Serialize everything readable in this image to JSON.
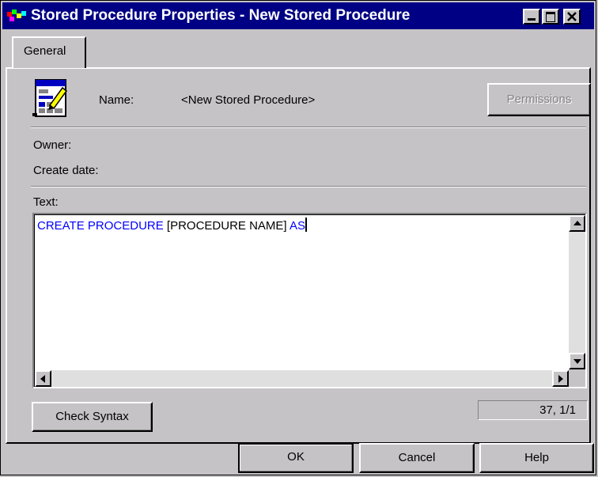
{
  "window": {
    "title": "Stored Procedure Properties - New Stored Procedure",
    "app_icon": "app-icon",
    "controls": [
      "minimize-icon",
      "maximize-icon",
      "close-icon"
    ]
  },
  "tabs": [
    {
      "label": "General",
      "selected": true
    }
  ],
  "general": {
    "name_label": "Name:",
    "name_value": "<New Stored Procedure>",
    "permissions_label": "Permissions",
    "owner_label": "Owner:",
    "create_date_label": "Create date:",
    "text_label": "Text:",
    "code": {
      "kw1": "CREATE PROCEDURE",
      "plain": " [PROCEDURE NAME] ",
      "kw2": "AS"
    },
    "check_syntax_label": "Check Syntax",
    "cursor_position": "37, 1/1"
  },
  "footer": {
    "ok_label": "OK",
    "cancel_label": "Cancel",
    "help_label": "Help"
  },
  "colors": {
    "titlebar": "#000084",
    "face": "#c6c3c6",
    "keyword": "#0000ff"
  }
}
